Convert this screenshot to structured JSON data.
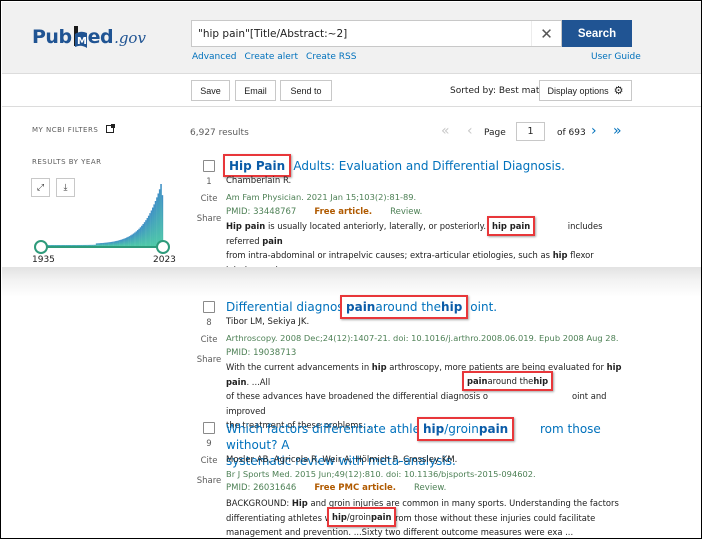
{
  "header": {
    "logo": {
      "pub": "Pub",
      "med": "Med",
      "gov": ".gov"
    },
    "search": {
      "value": "\"hip pain\"[Title/Abstract:~2]",
      "placeholder": ""
    },
    "search_button": "Search",
    "links": [
      "Advanced",
      "Create alert",
      "Create RSS"
    ],
    "user_guide": "User Guide"
  },
  "toolbar": {
    "save": "Save",
    "email": "Email",
    "send_to": "Send to",
    "sorted_by": "Sorted by: Best match",
    "display_options": "Display options"
  },
  "sidebar": {
    "my_ncbi_filters": "MY NCBI FILTERS",
    "results_by_year": "RESULTS BY YEAR",
    "year_start": "1935",
    "year_end": "2023",
    "expand_icon": "expand-icon",
    "download_icon": "download-icon"
  },
  "results_summary": {
    "count": "6,927 results",
    "page_label": "Page",
    "page": "1",
    "of_pages": "of 693"
  },
  "results": [
    {
      "number": "1",
      "title_rest": "n Adults: Evaluation and Differential Diagnosis.",
      "title_highlight": "Hip Pain",
      "authors": "Chamberlain R.",
      "journal": "Am Fam Physician. 2021 Jan 15;103(2):81-89.",
      "pmid": "PMID: 33448767",
      "free": "Free article.",
      "type": "Review.",
      "cite": "Cite",
      "share": "Share",
      "snippet": {
        "l1a": "Hip pain",
        "l1b": " is usually located anteriorly, laterally, or posteriorly. Anterio",
        "l1hl": "hip pain",
        "l1c": " includes referred ",
        "l1d": "pain",
        "l2a": "from intra-abdominal or intrapelvic causes; extra-articular etiologies, such as ",
        "l2b": "hip",
        "l2c": " flexor injuries; and",
        "l3": "intra-articular etiologie ..."
      }
    },
    {
      "number": "8",
      "title_pre": "Differential diagnosis o",
      "title_highlight_parts": [
        "pain",
        " around the ",
        "hip"
      ],
      "title_post": "oint.",
      "authors": "Tibor LM, Sekiya JK.",
      "journal": "Arthroscopy. 2008 Dec;24(12):1407-21. doi: 10.1016/j.arthro.2008.06.019. Epub 2008 Aug 28.",
      "pmid": "PMID: 19038713",
      "cite": "Cite",
      "share": "Share",
      "snippet": {
        "l1a": "With the current advancements in ",
        "l1b": "hip",
        "l1c": " arthroscopy, more patients are being evaluated for ",
        "l1d": "hip pain",
        "l1e": ". ...All",
        "l2a": "of these advances have broadened the differential diagnosis o",
        "l2hl": [
          "pain",
          " around the ",
          "hip"
        ],
        "l2c": "oint and improved",
        "l3": "the treatment of these problems. ..."
      }
    },
    {
      "number": "9",
      "title_pre": "Which factors differentiate athletes wit",
      "title_highlight_parts": [
        "hip",
        "/groin ",
        "pain"
      ],
      "title_post": "rom those without? A",
      "title_line2": "systematic review with meta-analysis.",
      "authors": "Mosler AB, Agricola R, Weir A, Hölmich P, Crossley KM.",
      "journal": "Br J Sports Med. 2015 Jun;49(12):810. doi: 10.1136/bjsports-2015-094602.",
      "pmid": "PMID: 26031646",
      "free": "Free PMC article.",
      "type": "Review.",
      "cite": "Cite",
      "share": "Share",
      "snippet": {
        "l1a": "BACKGROUND: ",
        "l1b": "Hip",
        "l1c": " and groin injuries are common in many sports. Understanding the factors",
        "l2a": "differentiating athletes wit",
        "l2hl": [
          "hip",
          "/groin ",
          "pain"
        ],
        "l2c": "rom those without these injuries could facilitate",
        "l3": "management and prevention. ...Sixty two different outcome measures were exa ..."
      }
    }
  ],
  "colors": {
    "brand": "#205493",
    "link": "#0071bc",
    "highlight_box": "#e8373a",
    "free_article": "#b05a00",
    "journal_green": "#4d8055",
    "chart_start": "#4fc9a8",
    "chart_end": "#3f8fc6"
  }
}
